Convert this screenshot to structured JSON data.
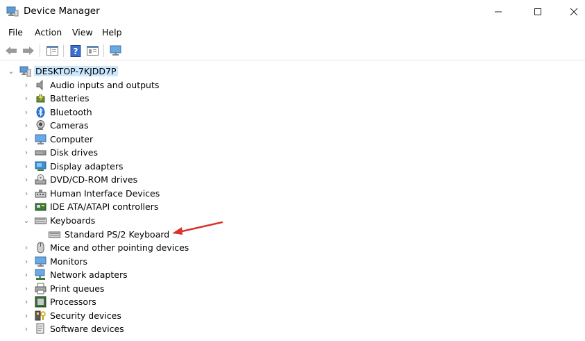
{
  "window": {
    "title": "Device Manager",
    "controls": {
      "minimize": "—",
      "maximize": "☐",
      "close": "✕"
    }
  },
  "menu": [
    "File",
    "Action",
    "View",
    "Help"
  ],
  "tree": {
    "root": "DESKTOP-7KJDD7P",
    "items": [
      {
        "label": "Audio inputs and outputs",
        "icon": "speaker-icon"
      },
      {
        "label": "Batteries",
        "icon": "battery-icon"
      },
      {
        "label": "Bluetooth",
        "icon": "bluetooth-icon"
      },
      {
        "label": "Cameras",
        "icon": "camera-icon"
      },
      {
        "label": "Computer",
        "icon": "computer-icon"
      },
      {
        "label": "Disk drives",
        "icon": "disk-drive-icon"
      },
      {
        "label": "Display adapters",
        "icon": "display-adapter-icon"
      },
      {
        "label": "DVD/CD-ROM drives",
        "icon": "dvd-drive-icon"
      },
      {
        "label": "Human Interface Devices",
        "icon": "hid-icon"
      },
      {
        "label": "IDE ATA/ATAPI controllers",
        "icon": "ide-controller-icon"
      },
      {
        "label": "Keyboards",
        "icon": "keyboard-icon",
        "expanded": true,
        "children": [
          {
            "label": "Standard PS/2 Keyboard",
            "icon": "keyboard-icon"
          }
        ]
      },
      {
        "label": "Mice and other pointing devices",
        "icon": "mouse-icon"
      },
      {
        "label": "Monitors",
        "icon": "monitor-icon"
      },
      {
        "label": "Network adapters",
        "icon": "network-adapter-icon"
      },
      {
        "label": "Print queues",
        "icon": "printer-icon"
      },
      {
        "label": "Processors",
        "icon": "processor-icon"
      },
      {
        "label": "Security devices",
        "icon": "security-device-icon"
      },
      {
        "label": "Software devices",
        "icon": "software-device-icon"
      }
    ]
  },
  "colors": {
    "selection": "#cce8ff",
    "annotation_arrow": "#d9342b",
    "icon_blue": "#2f7fd6",
    "icon_gray": "#8a8a8a"
  }
}
